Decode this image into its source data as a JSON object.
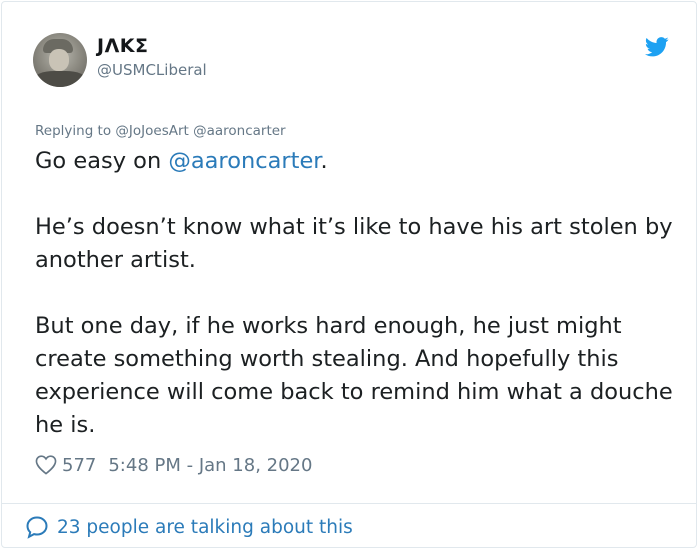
{
  "user": {
    "display_name": "JΛKΣ",
    "handle": "@USMCLiberal",
    "avatar_icon": "user-avatar"
  },
  "brand": {
    "icon": "twitter-bird-icon",
    "color": "#1da1f2"
  },
  "reply": {
    "prefix": "Replying to ",
    "mentions": "@JoJoesArt @aaroncarter"
  },
  "tweet": {
    "line1_before": "Go easy on ",
    "line1_mention": "@aaroncarter",
    "line1_after": ".",
    "paragraph2": "He’s doesn’t know what it’s like to have his art stolen by another artist.",
    "paragraph3": "But one day, if he works hard enough, he just might create something worth stealing. And hopefully this experience will come back to remind him what a douche he is."
  },
  "meta": {
    "likes": "577",
    "timestamp": "5:48 PM - Jan 18, 2020"
  },
  "footer": {
    "talking": "23 people are talking about this"
  },
  "colors": {
    "link": "#2b7bb9",
    "muted": "#657786",
    "text": "#1c2022",
    "border": "#e1e8ed"
  }
}
